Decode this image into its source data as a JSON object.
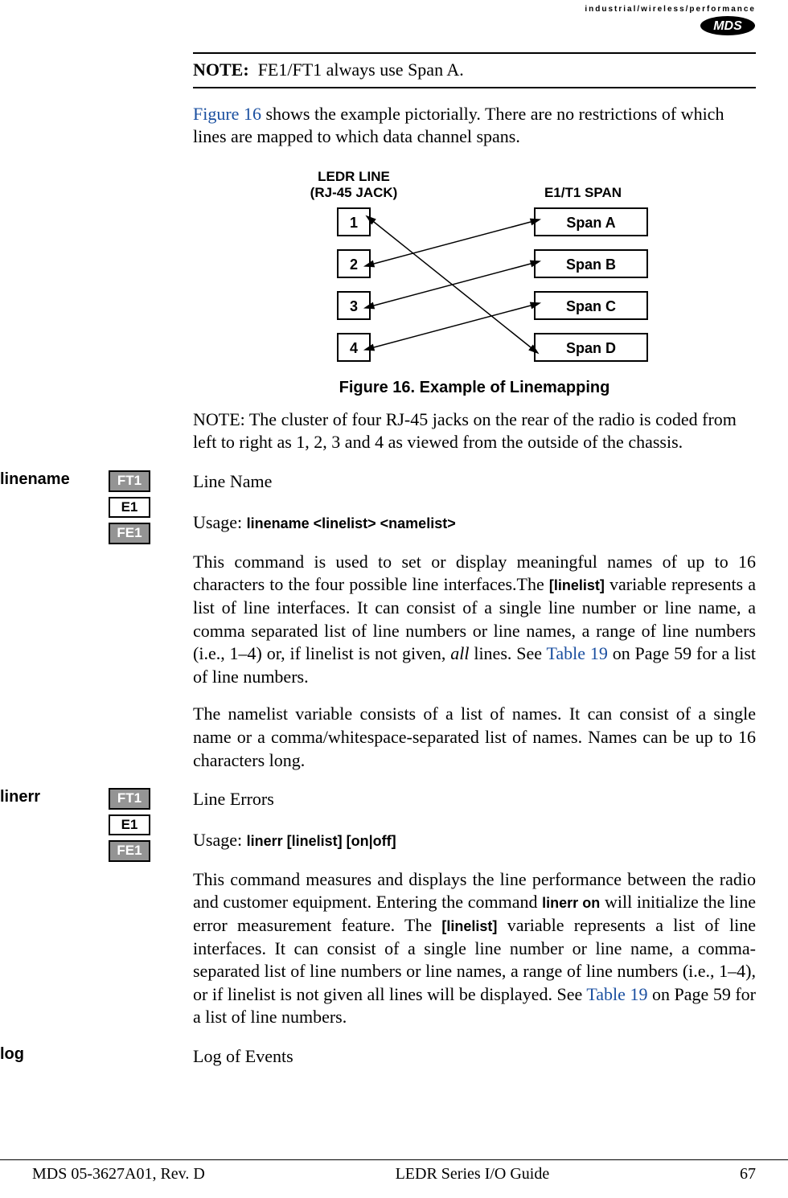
{
  "header": {
    "tagline": "industrial/wireless/performance",
    "logo_text": "MDS"
  },
  "note_box": {
    "label": "NOTE:",
    "text": "FE1/FT1 always use Span A."
  },
  "intro_para": {
    "ref": "Figure 16",
    "rest": " shows the example pictorially. There are no restrictions of which lines are mapped to which data channel spans."
  },
  "diagram": {
    "left_title_line1": "LEDR LINE",
    "left_title_line2": "(RJ-45 JACK)",
    "right_title": "E1/T1 SPAN",
    "lines": [
      "1",
      "2",
      "3",
      "4"
    ],
    "spans": [
      "Span A",
      "Span B",
      "Span C",
      "Span D"
    ]
  },
  "figure_caption": "Figure 16. Example of Linemapping",
  "note_para": "NOTE: The cluster of four RJ-45 jacks on the rear of the radio is coded from left to right as 1, 2, 3 and 4 as viewed from the outside of the chassis.",
  "sections": {
    "linename": {
      "margin_label": "linename",
      "badges": [
        "FT1",
        "E1",
        "FE1"
      ],
      "title": "Line Name",
      "usage_label": "Usage: ",
      "usage_code": "linename <linelist> <namelist>",
      "para1_a": "This command is used to set or display meaningful names of up to 16 characters to the four possible line interfaces.The ",
      "para1_code1": "[linelist]",
      "para1_b": " variable represents a list of line interfaces. It can consist of a single line number or line name, a comma separated list of line numbers or line names, a range of line numbers (i.e., 1–4) or, if linelist is not given, ",
      "para1_all": "all",
      "para1_c": " lines. See ",
      "para1_ref": "Table 19",
      "para1_d": " on Page 59 for a list of line numbers.",
      "para2": "The namelist variable consists of a list of names. It can consist of a single name or a comma/whitespace-separated list of names. Names can be up to 16 characters long."
    },
    "linerr": {
      "margin_label": "linerr",
      "badges": [
        "FT1",
        "E1",
        "FE1"
      ],
      "title": "Line Errors",
      "usage_label": "Usage: ",
      "usage_code": "linerr [linelist] [on|off]",
      "para1_a": "This command measures and displays the line performance between the radio and customer equipment. Entering the command ",
      "para1_code1": "linerr on",
      "para1_b": " will initialize the line error measurement feature. The ",
      "para1_code2": "[linelist]",
      "para1_c": " variable represents a list of line interfaces. It can consist of a single line number or line name, a comma-separated list of line numbers or line names, a range of line numbers (i.e., 1–4), or if linelist is not given all lines will be displayed. See ",
      "para1_ref": "Table 19",
      "para1_d": " on Page 59 for a list of line numbers."
    },
    "log": {
      "margin_label": "log",
      "title": "Log of Events"
    }
  },
  "footer": {
    "left": "MDS 05-3627A01, Rev. D",
    "center": "LEDR Series I/O Guide",
    "right": "67"
  }
}
